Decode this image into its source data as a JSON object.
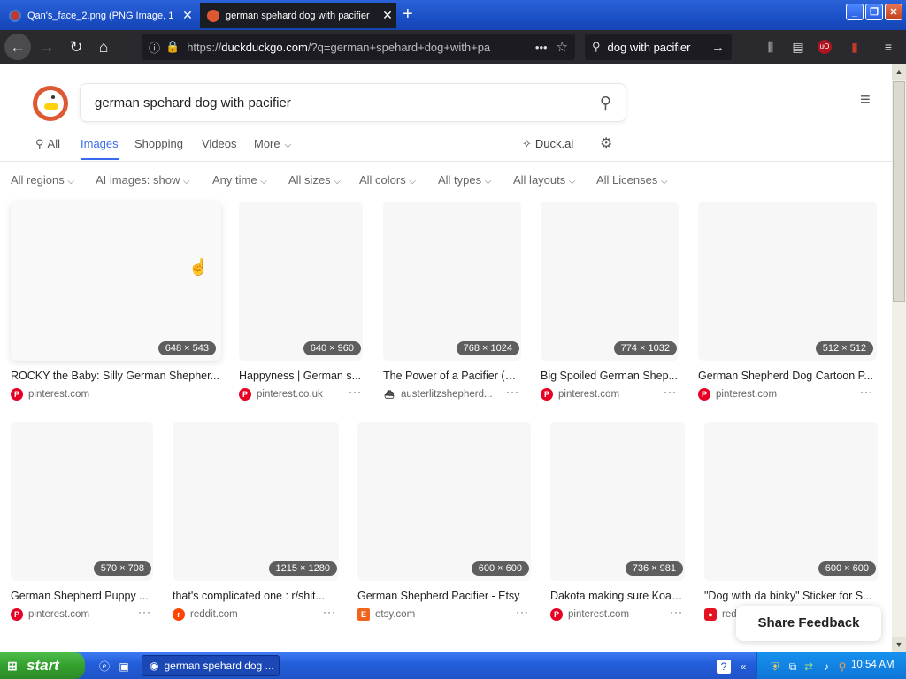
{
  "browser": {
    "tabs": [
      {
        "title": "Qan's_face_2.png (PNG Image, 1",
        "favicon": "image-file-icon"
      },
      {
        "title": "german spehard dog with pacifier",
        "favicon": "duckduckgo-icon"
      }
    ],
    "url": {
      "scheme": "https://",
      "host": "duckduckgo.com",
      "path": "/?q=german+spehard+dog+with+pa"
    },
    "search_bar_value": "dog with pacifier"
  },
  "ddg": {
    "query": "german spehard dog with pacifier",
    "tabs": [
      "All",
      "Images",
      "Shopping",
      "Videos",
      "More"
    ],
    "active_tab": "Images",
    "duck_ai": "Duck.ai",
    "filters": [
      "All regions",
      "AI images: show",
      "Any time",
      "All sizes",
      "All colors",
      "All types",
      "All layouts",
      "All Licenses"
    ]
  },
  "results": [
    {
      "dims": "648 × 543",
      "title": "ROCKY the Baby: Silly German Shepher...",
      "source": "pinterest.com",
      "source_icon": "pinterest-icon"
    },
    {
      "dims": "640 × 960",
      "title": "Happyness | German s...",
      "source": "pinterest.co.uk",
      "source_icon": "pinterest-icon"
    },
    {
      "dims": "768 × 1024",
      "title": "The Power of a Pacifier (B...",
      "source": "austerlitzshepherd...",
      "source_icon": "ship-icon"
    },
    {
      "dims": "774 × 1032",
      "title": "Big Spoiled German Shep...",
      "source": "pinterest.com",
      "source_icon": "pinterest-icon"
    },
    {
      "dims": "512 × 512",
      "title": "German Shepherd Dog Cartoon P...",
      "source": "pinterest.com",
      "source_icon": "pinterest-icon"
    },
    {
      "dims": "570 × 708",
      "title": "German Shepherd Puppy ...",
      "source": "pinterest.com",
      "source_icon": "pinterest-icon"
    },
    {
      "dims": "1215 × 1280",
      "title": "that's complicated one : r/shit...",
      "source": "reddit.com",
      "source_icon": "reddit-icon"
    },
    {
      "dims": "600 × 600",
      "title": "German Shepherd Pacifier - Etsy",
      "source": "etsy.com",
      "source_icon": "etsy-icon"
    },
    {
      "dims": "736 × 981",
      "title": "Dakota making sure Koal ...",
      "source": "pinterest.com",
      "source_icon": "pinterest-icon"
    },
    {
      "dims": "600 × 600",
      "title": "\"Dog with da binky\" Sticker for S...",
      "source": "red",
      "source_icon": "redbubble-icon"
    }
  ],
  "feedback": "Share Feedback",
  "taskbar": {
    "start": "start",
    "window": "german spehard dog ...",
    "clock": "10:54 AM"
  },
  "colors": {
    "accent": "#3969ef",
    "ddg_orange": "#de5833",
    "pinterest": "#e60023",
    "reddit": "#ff4500",
    "etsy": "#f1641e"
  }
}
